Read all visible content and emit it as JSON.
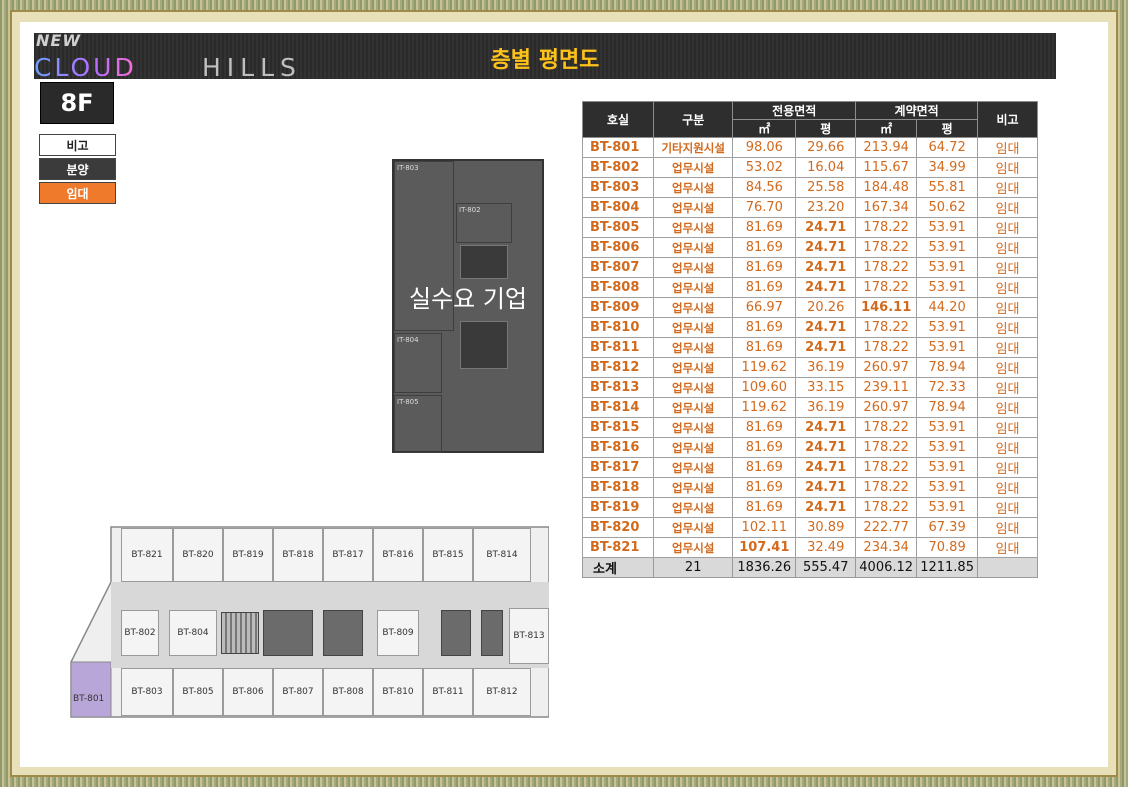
{
  "header": {
    "logo_new": "NEW",
    "logo_cloud": "CLOUD",
    "logo_hills": "HILLS",
    "title": "층별 평면도"
  },
  "floor_label": "8F",
  "legend": {
    "note": "비고",
    "sale": "분양",
    "rent": "임대"
  },
  "plan_top": {
    "overlay_label": "실수요 기업",
    "rooms": [
      "IT-803",
      "IT-802",
      "IT-804",
      "IT-805"
    ]
  },
  "plan_bottom": {
    "top_row": [
      "BT-821",
      "BT-820",
      "BT-819",
      "BT-818",
      "BT-817",
      "BT-816",
      "BT-815",
      "BT-814"
    ],
    "middle": [
      "BT-802",
      "BT-804",
      "BT-809",
      "BT-813"
    ],
    "bottom_row": [
      "BT-803",
      "BT-805",
      "BT-806",
      "BT-807",
      "BT-808",
      "BT-810",
      "BT-811",
      "BT-812"
    ],
    "corner": "BT-801"
  },
  "table": {
    "headers": {
      "unit": "호실",
      "type": "구분",
      "exclusive": "전용면적",
      "contract": "계약면적",
      "note": "비고",
      "sqm": "㎡",
      "pyeong": "평"
    },
    "rows": [
      {
        "unit": "BT-801",
        "type": "기타지원시설",
        "ex_m2": "98.06",
        "ex_py": "29.66",
        "ct_m2": "213.94",
        "ct_py": "64.72",
        "note": "임대"
      },
      {
        "unit": "BT-802",
        "type": "업무시설",
        "ex_m2": "53.02",
        "ex_py": "16.04",
        "ct_m2": "115.67",
        "ct_py": "34.99",
        "note": "임대"
      },
      {
        "unit": "BT-803",
        "type": "업무시설",
        "ex_m2": "84.56",
        "ex_py": "25.58",
        "ct_m2": "184.48",
        "ct_py": "55.81",
        "note": "임대"
      },
      {
        "unit": "BT-804",
        "type": "업무시설",
        "ex_m2": "76.70",
        "ex_py": "23.20",
        "ct_m2": "167.34",
        "ct_py": "50.62",
        "note": "임대"
      },
      {
        "unit": "BT-805",
        "type": "업무시설",
        "ex_m2": "81.69",
        "ex_py": "24.71",
        "ct_m2": "178.22",
        "ct_py": "53.91",
        "note": "임대"
      },
      {
        "unit": "BT-806",
        "type": "업무시설",
        "ex_m2": "81.69",
        "ex_py": "24.71",
        "ct_m2": "178.22",
        "ct_py": "53.91",
        "note": "임대"
      },
      {
        "unit": "BT-807",
        "type": "업무시설",
        "ex_m2": "81.69",
        "ex_py": "24.71",
        "ct_m2": "178.22",
        "ct_py": "53.91",
        "note": "임대"
      },
      {
        "unit": "BT-808",
        "type": "업무시설",
        "ex_m2": "81.69",
        "ex_py": "24.71",
        "ct_m2": "178.22",
        "ct_py": "53.91",
        "note": "임대"
      },
      {
        "unit": "BT-809",
        "type": "업무시설",
        "ex_m2": "66.97",
        "ex_py": "20.26",
        "ct_m2": "146.11",
        "ct_py": "44.20",
        "note": "임대"
      },
      {
        "unit": "BT-810",
        "type": "업무시설",
        "ex_m2": "81.69",
        "ex_py": "24.71",
        "ct_m2": "178.22",
        "ct_py": "53.91",
        "note": "임대"
      },
      {
        "unit": "BT-811",
        "type": "업무시설",
        "ex_m2": "81.69",
        "ex_py": "24.71",
        "ct_m2": "178.22",
        "ct_py": "53.91",
        "note": "임대"
      },
      {
        "unit": "BT-812",
        "type": "업무시설",
        "ex_m2": "119.62",
        "ex_py": "36.19",
        "ct_m2": "260.97",
        "ct_py": "78.94",
        "note": "임대"
      },
      {
        "unit": "BT-813",
        "type": "업무시설",
        "ex_m2": "109.60",
        "ex_py": "33.15",
        "ct_m2": "239.11",
        "ct_py": "72.33",
        "note": "임대"
      },
      {
        "unit": "BT-814",
        "type": "업무시설",
        "ex_m2": "119.62",
        "ex_py": "36.19",
        "ct_m2": "260.97",
        "ct_py": "78.94",
        "note": "임대"
      },
      {
        "unit": "BT-815",
        "type": "업무시설",
        "ex_m2": "81.69",
        "ex_py": "24.71",
        "ct_m2": "178.22",
        "ct_py": "53.91",
        "note": "임대"
      },
      {
        "unit": "BT-816",
        "type": "업무시설",
        "ex_m2": "81.69",
        "ex_py": "24.71",
        "ct_m2": "178.22",
        "ct_py": "53.91",
        "note": "임대"
      },
      {
        "unit": "BT-817",
        "type": "업무시설",
        "ex_m2": "81.69",
        "ex_py": "24.71",
        "ct_m2": "178.22",
        "ct_py": "53.91",
        "note": "임대"
      },
      {
        "unit": "BT-818",
        "type": "업무시설",
        "ex_m2": "81.69",
        "ex_py": "24.71",
        "ct_m2": "178.22",
        "ct_py": "53.91",
        "note": "임대"
      },
      {
        "unit": "BT-819",
        "type": "업무시설",
        "ex_m2": "81.69",
        "ex_py": "24.71",
        "ct_m2": "178.22",
        "ct_py": "53.91",
        "note": "임대"
      },
      {
        "unit": "BT-820",
        "type": "업무시설",
        "ex_m2": "102.11",
        "ex_py": "30.89",
        "ct_m2": "222.77",
        "ct_py": "67.39",
        "note": "임대"
      },
      {
        "unit": "BT-821",
        "type": "업무시설",
        "ex_m2": "107.41",
        "ex_py": "32.49",
        "ct_m2": "234.34",
        "ct_py": "70.89",
        "note": "임대"
      }
    ],
    "total": {
      "label": "소계",
      "count": "21",
      "ex_m2": "1836.26",
      "ex_py": "555.47",
      "ct_m2": "4006.12",
      "ct_py": "1211.85",
      "note": ""
    }
  },
  "colors": {
    "accent_orange": "#ef7a2c",
    "text_orange": "#d26a1e",
    "title_yellow": "#ffc21a",
    "header_dark": "#2e2e2e"
  }
}
